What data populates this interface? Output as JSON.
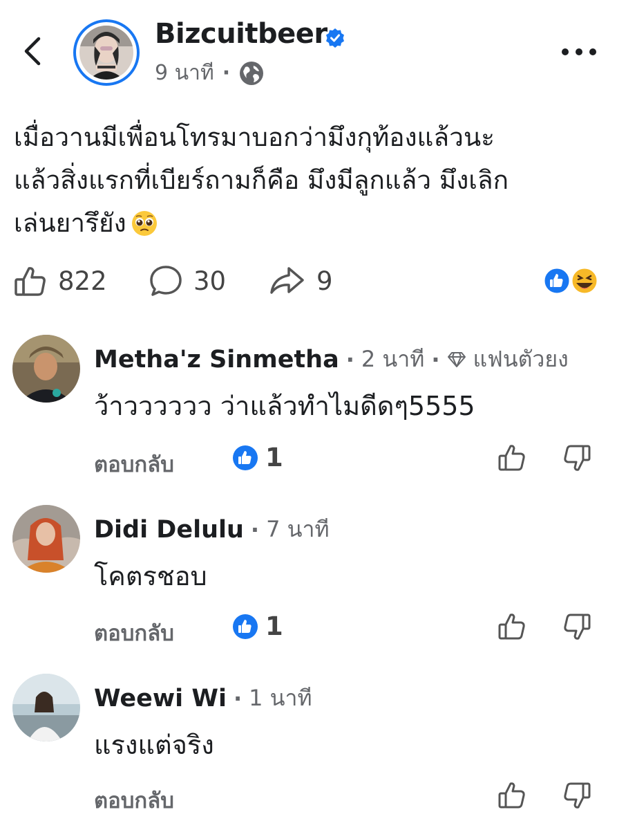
{
  "header": {
    "author": "Bizcuitbeer",
    "time": "9 นาที",
    "privacy_icon": "globe-icon",
    "verified_icon": "verified-badge-icon"
  },
  "post": {
    "text": "เมื่อวานมีเพื่อนโทรมาบอกว่ามึงกุท้องแล้วนะ\nแล้วสิ่งแรกที่เบียร์ถามก็คือ มึงมีลูกแล้ว มึงเลิก\nเล่นยารึยัง",
    "emoji": "pleading-face-emoji"
  },
  "stats": {
    "likes": "822",
    "comments": "30",
    "shares": "9",
    "reaction_icons": [
      "like-reaction-icon",
      "haha-reaction-icon"
    ]
  },
  "comments": [
    {
      "name": "Metha'z Sinmetha",
      "time": "2 นาที",
      "badge": "แฟนตัวยง",
      "text": "ว้าวววววว ว่าแล้วทำไมดีดๆ5555",
      "reply_label": "ตอบกลับ",
      "likes": "1"
    },
    {
      "name": "Didi Delulu",
      "time": "7 นาที",
      "text": "โคตรชอบ",
      "reply_label": "ตอบกลับ",
      "likes": "1"
    },
    {
      "name": "Weewi Wi",
      "time": "1 นาที",
      "text": "แรงแต่จริง",
      "reply_label": "ตอบกลับ"
    }
  ],
  "colors": {
    "accent": "#1877f2",
    "text": "#1c1e21",
    "secondary": "#65676b"
  }
}
